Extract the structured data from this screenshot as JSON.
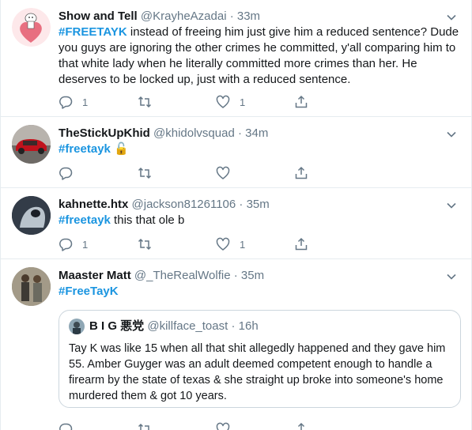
{
  "tweets": [
    {
      "name": "Show and Tell",
      "handle": "@KrayheAzadai",
      "dot": "·",
      "time": "33m",
      "hashtag": "#FREETAYK",
      "text": " instead of freeing him just give him a reduced sentence? Dude you guys are ignoring the other crimes he committed, y'all comparing him to that white lady when he literally committed more crimes than her.  He deserves to be locked up,  just with a reduced sentence.",
      "reply_count": "1",
      "retweet_count": "",
      "like_count": "1"
    },
    {
      "name": "TheStickUpKhid",
      "handle": "@khidolvsquad",
      "dot": "·",
      "time": "34m",
      "hashtag": "#freetayk",
      "text": " 🔓",
      "reply_count": "",
      "retweet_count": "",
      "like_count": ""
    },
    {
      "name": "kahnette.htx",
      "handle": "@jackson81261106",
      "dot": "·",
      "time": "35m",
      "hashtag": "#freetayk",
      "text": " this that ole b",
      "reply_count": "1",
      "retweet_count": "",
      "like_count": "1"
    },
    {
      "name": "Maaster Matt",
      "handle": "@_TheRealWolfie",
      "dot": "·",
      "time": "35m",
      "hashtag": "#FreeTayK",
      "text": "",
      "quote": {
        "name": "B I G 悪党",
        "handle": "@killface_toast",
        "dot": "·",
        "time": "16h",
        "text": "Tay K was like 15 when all that shit allegedly happened and they gave him 55. Amber Guyger was an adult deemed competent enough to handle a firearm by the state of texas & she straight up broke into someone's home  murdered them & got 10 years."
      }
    }
  ],
  "colors": {
    "accent": "#1b95e0",
    "muted": "#657786",
    "text": "#14171a",
    "border": "#e6ecf0"
  }
}
